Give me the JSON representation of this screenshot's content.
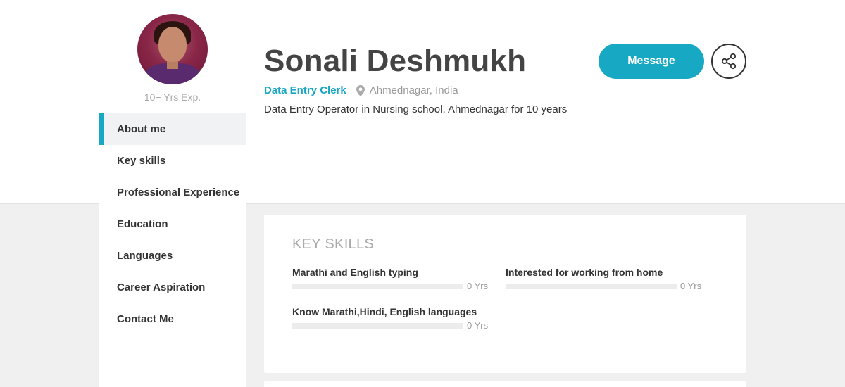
{
  "profile": {
    "experience": "10+ Yrs Exp.",
    "name": "Sonali Deshmukh",
    "role": "Data Entry Clerk",
    "location": "Ahmednagar, India",
    "tagline": "Data Entry Operator in Nursing school, Ahmednagar for 10 years"
  },
  "actions": {
    "message_label": "Message",
    "share_icon": "share-icon"
  },
  "sidebar": {
    "items": [
      {
        "label": "About me",
        "active": true
      },
      {
        "label": "Key skills"
      },
      {
        "label": "Professional Experience"
      },
      {
        "label": "Education"
      },
      {
        "label": "Languages"
      },
      {
        "label": "Career Aspiration"
      },
      {
        "label": "Contact Me"
      }
    ]
  },
  "key_skills": {
    "title": "KEY SKILLS",
    "skills": [
      {
        "name": "Marathi and English typing",
        "years": "0 Yrs",
        "level": 0
      },
      {
        "name": "Interested for working from home",
        "years": "0 Yrs",
        "level": 0
      },
      {
        "name": "Know Marathi,Hindi, English languages",
        "years": "0 Yrs",
        "level": 0
      }
    ]
  },
  "colors": {
    "accent": "#17a9c4",
    "background": "#f0f0f0"
  }
}
